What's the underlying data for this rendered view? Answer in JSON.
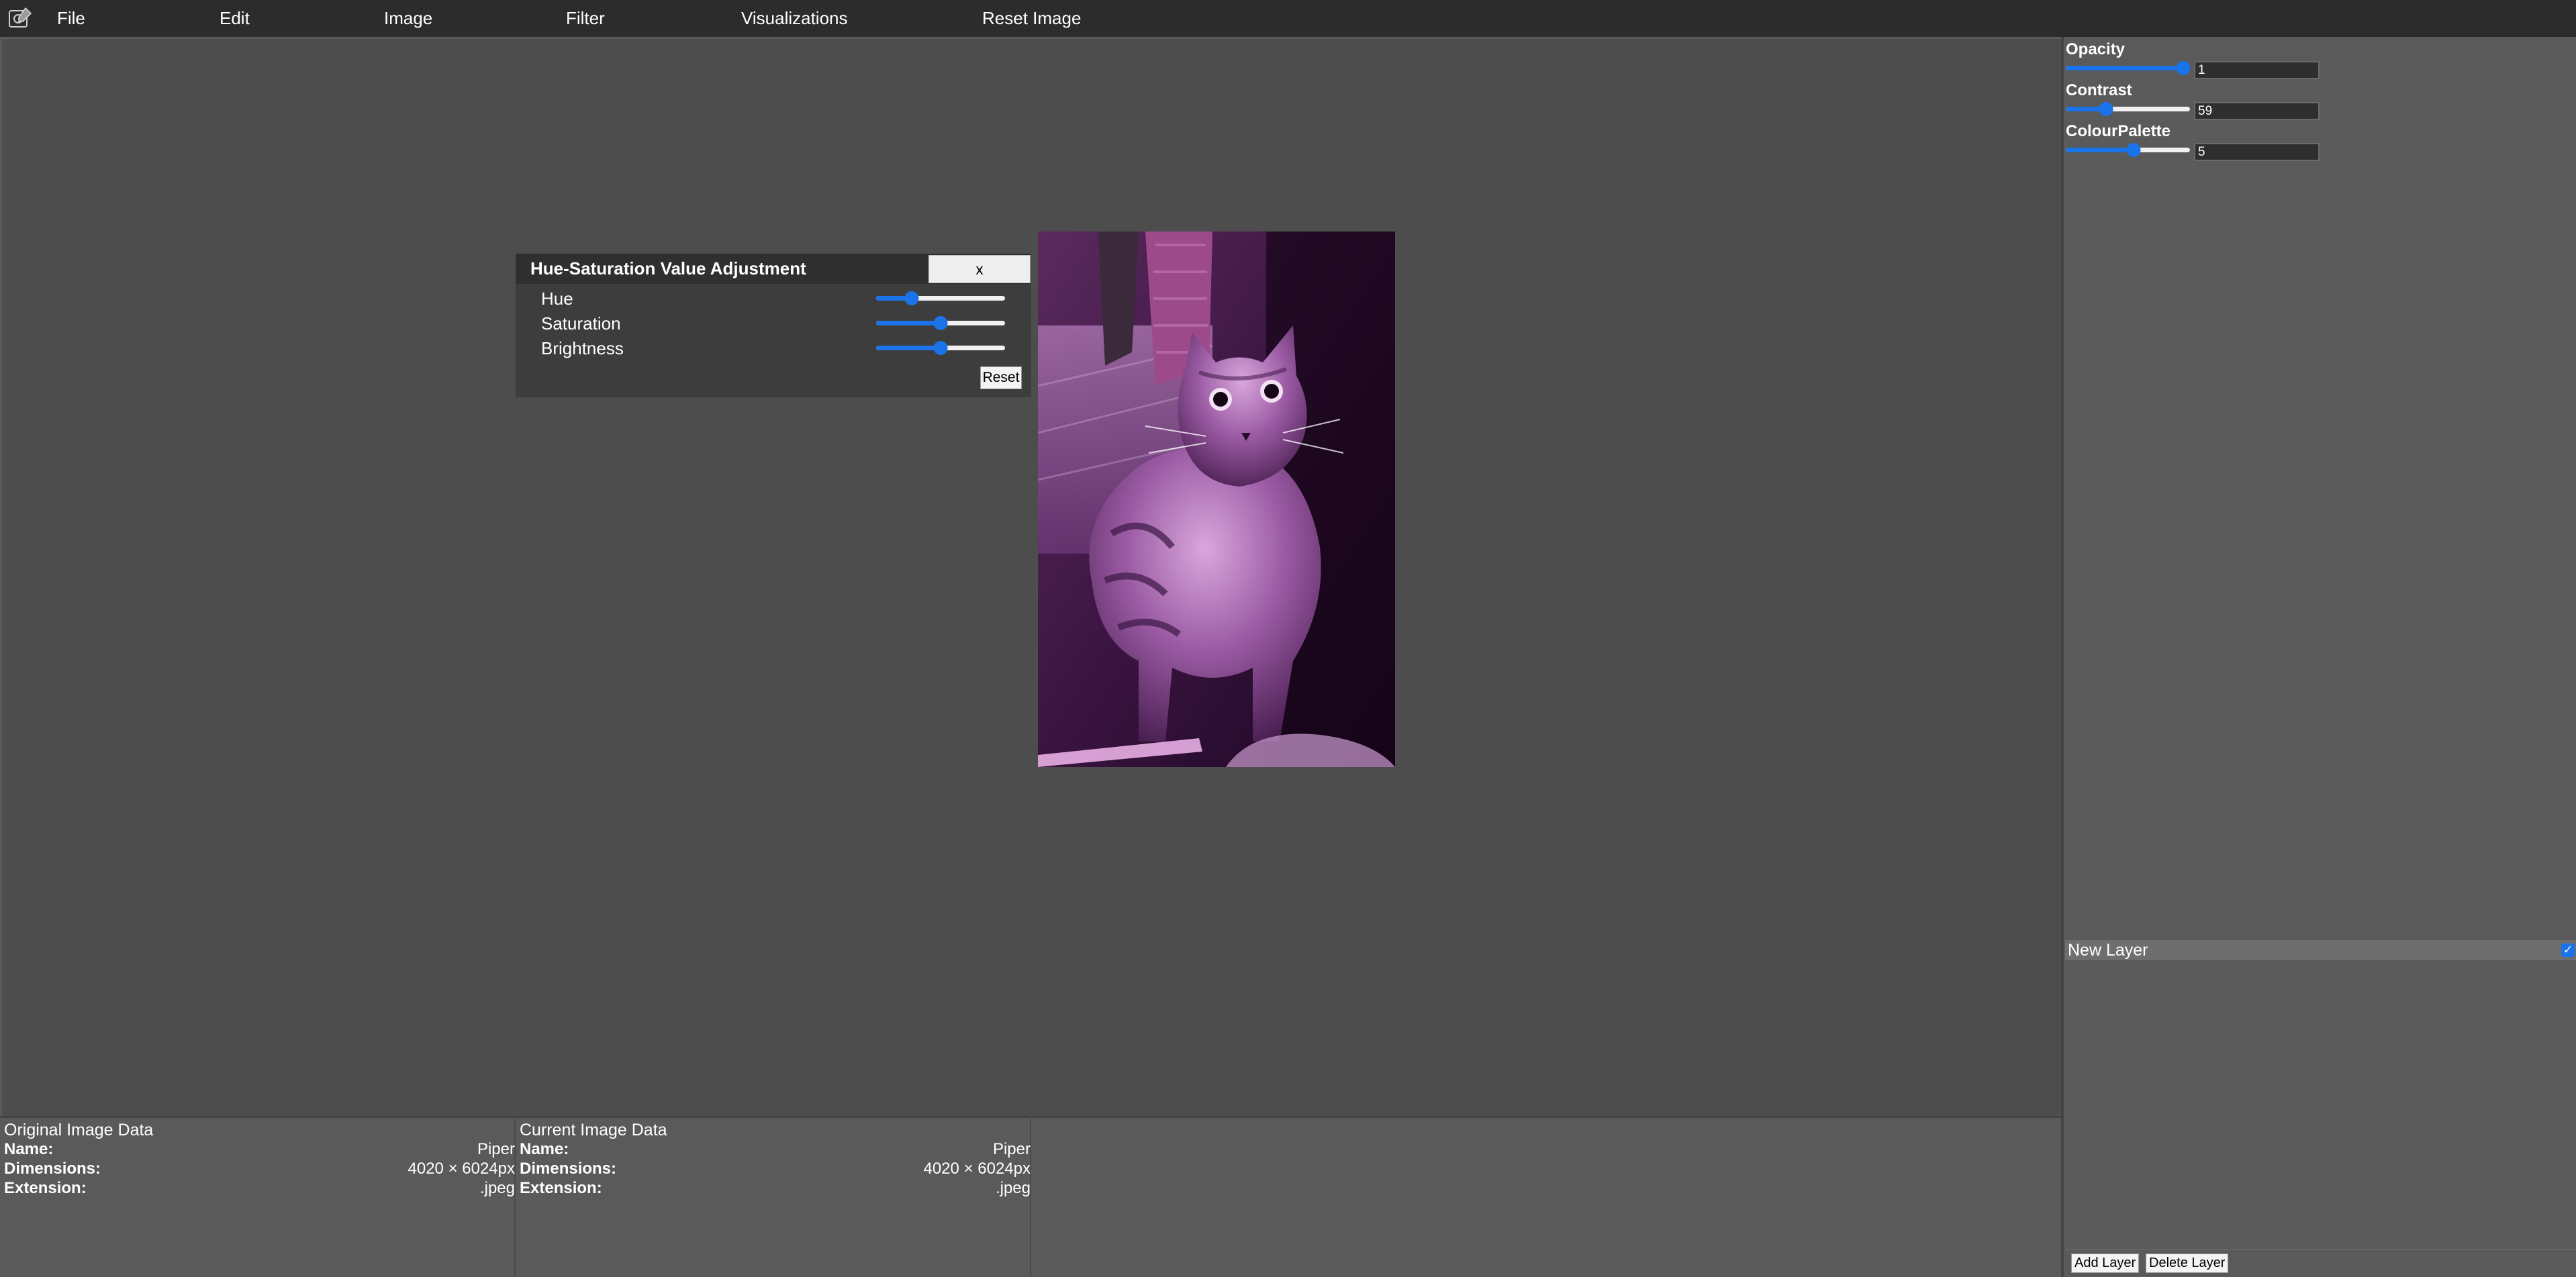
{
  "menu": {
    "items": [
      "File",
      "Edit",
      "Image",
      "Filter",
      "Visualizations",
      "Reset Image"
    ]
  },
  "hsv_dialog": {
    "title": "Hue-Saturation Value Adjustment",
    "close_label": "x",
    "sliders": [
      {
        "label": "Hue",
        "fraction": 0.25
      },
      {
        "label": "Saturation",
        "fraction": 0.5
      },
      {
        "label": "Brightness",
        "fraction": 0.5
      }
    ],
    "reset_label": "Reset"
  },
  "image": {
    "description_icon": "cat-photo-icon",
    "tint": "#a020a0"
  },
  "properties": {
    "opacity": {
      "label": "Opacity",
      "value": "1",
      "fraction": 1.0
    },
    "contrast": {
      "label": "Contrast",
      "value": "59",
      "fraction": 0.3
    },
    "colour_palette": {
      "label": "ColourPalette",
      "value": "5",
      "fraction": 0.55
    }
  },
  "layers": {
    "items": [
      {
        "name": "New Layer",
        "visible": true
      }
    ],
    "add_label": "Add Layer",
    "delete_label": "Delete Layer"
  },
  "info": {
    "original": {
      "heading": "Original Image Data",
      "name_key": "Name:",
      "name": "Piper",
      "dimensions_key": "Dimensions:",
      "dimensions": "4020 × 6024px",
      "extension_key": "Extension:",
      "extension": ".jpeg"
    },
    "current": {
      "heading": "Current Image Data",
      "name_key": "Name:",
      "name": "Piper",
      "dimensions_key": "Dimensions:",
      "dimensions": "4020 × 6024px",
      "extension_key": "Extension:",
      "extension": ".jpeg"
    }
  },
  "colors": {
    "accent": "#1a73e8",
    "menubar": "#2c2c2c",
    "workspace": "#4d4d4d",
    "panel": "#5a5a5a"
  }
}
